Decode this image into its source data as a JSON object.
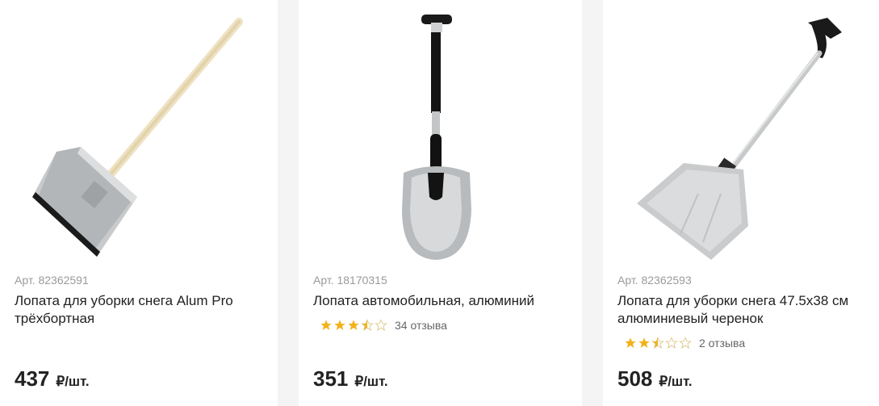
{
  "products": [
    {
      "image": "snow-shovel-wooden-handle",
      "article": "Арт. 82362591",
      "title": "Лопата для уборки снега Alum Pro трёхбортная",
      "price": "437",
      "unit": "₽/шт."
    },
    {
      "image": "car-shovel-aluminium",
      "article": "Арт. 18170315",
      "title": "Лопата автомобильная, алюминий",
      "rating_value": 3.5,
      "reviews": "34 отзыва",
      "price": "351",
      "unit": "₽/шт."
    },
    {
      "image": "snow-shovel-aluminium-handle",
      "article": "Арт. 82362593",
      "title": "Лопата для уборки снега 47.5x38 см алюминиевый черенок",
      "rating_value": 2.5,
      "reviews": "2 отзыва",
      "price": "508",
      "unit": "₽/шт."
    }
  ],
  "colors": {
    "star_filled": "#f2b21a",
    "star_empty": "#d9c27a",
    "background": "#f4f4f4"
  }
}
